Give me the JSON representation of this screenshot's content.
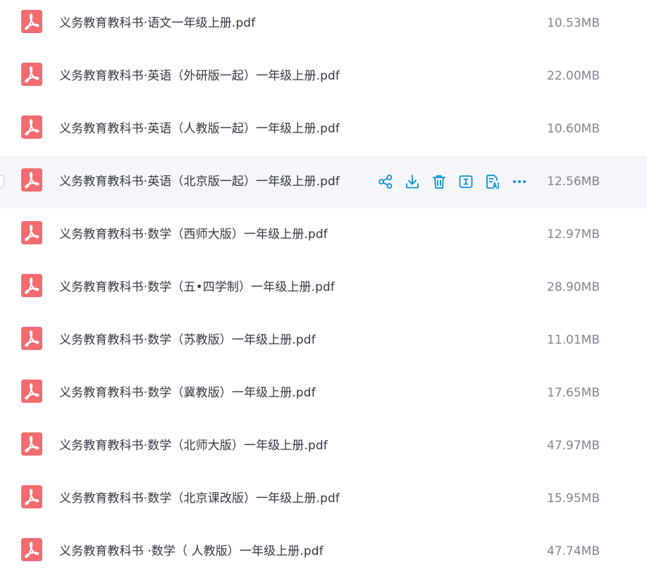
{
  "files": [
    {
      "name": "义务教育教科书·语文一年级上册.pdf",
      "size": "10.53MB"
    },
    {
      "name": "义务教育教科书·英语（外研版一起）一年级上册.pdf",
      "size": "22.00MB"
    },
    {
      "name": "义务教育教科书·英语（人教版一起）一年级上册.pdf",
      "size": "10.60MB"
    },
    {
      "name": "义务教育教科书·英语（北京版一起）一年级上册.pdf",
      "size": "12.56MB"
    },
    {
      "name": "义务教育教科书·数学（西师大版）一年级上册.pdf",
      "size": "12.97MB"
    },
    {
      "name": "义务教育教科书·数学（五•四学制）一年级上册.pdf",
      "size": "28.90MB"
    },
    {
      "name": "义务教育教科书·数学（苏教版）一年级上册.pdf",
      "size": "11.01MB"
    },
    {
      "name": "义务教育教科书·数学（冀教版）一年级上册.pdf",
      "size": "17.65MB"
    },
    {
      "name": "义务教育教科书·数学（北师大版）一年级上册.pdf",
      "size": "47.97MB"
    },
    {
      "name": "义务教育教科书·数学（北京课改版）一年级上册.pdf",
      "size": "15.95MB"
    },
    {
      "name": "义务教育教科书 ·数学（ 人教版）一年级上册.pdf",
      "size": "47.74MB"
    }
  ],
  "hovered_row": 3,
  "file_icon": "pdf-icon",
  "row_actions": [
    "share-icon",
    "download-icon",
    "delete-icon",
    "rename-icon",
    "ai-summary-icon",
    "more-icon"
  ],
  "colors": {
    "pdf_icon": "#f26b71",
    "action_icon": "#0a8fd8",
    "hover_bg": "#f5f6fa",
    "name_text": "#333740",
    "size_text": "#81858e"
  }
}
